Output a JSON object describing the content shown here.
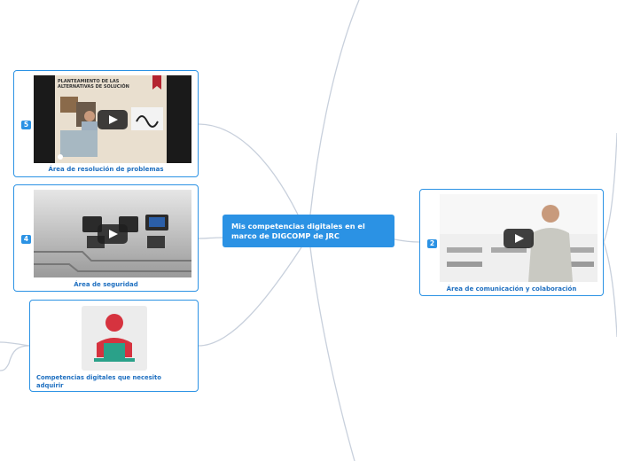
{
  "central_topic": "Mis competencias digitales en el marco de DIGCOMP de JRC",
  "nodes": [
    {
      "number": "5",
      "caption": "Área de resolución de problemas",
      "video_title": "PLANTEAMIENTO DE LAS ALTERNATIVAS DE SOLUCIÓN",
      "thumb_icon": "video-thumbnail",
      "play_icon": "play-icon"
    },
    {
      "number": "4",
      "caption": "Área de seguridad",
      "thumb_icon": "video-thumbnail",
      "play_icon": "play-icon"
    },
    {
      "caption": "Competencias digitales que necesito adquirir",
      "image_icon": "person-at-computer-icon"
    },
    {
      "number": "2",
      "caption": "Área de comunicación y colaboración",
      "thumb_icon": "video-thumbnail",
      "play_icon": "play-icon"
    }
  ],
  "colors": {
    "accent": "#2b92e4",
    "caption_text": "#1e6fc0",
    "link_lines": "#c8d0dc",
    "icon_red": "#d6333f",
    "icon_green": "#2aa189"
  }
}
